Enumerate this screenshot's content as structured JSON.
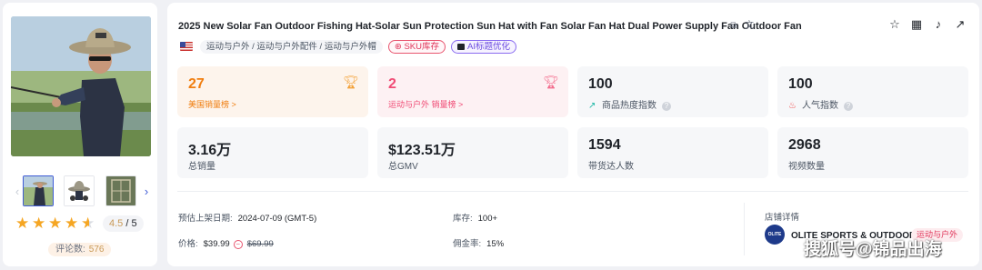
{
  "gallery": {
    "rating_score": "4.5",
    "rating_max": "/ 5",
    "rating_value": 4.5,
    "review_label": "评论数:",
    "review_count": "576"
  },
  "product": {
    "title": "2025 New Solar Fan Outdoor Fishing Hat-Solar Sun Protection Sun Hat with Fan Solar Fan Hat Dual Power Supply Fan Outdoor Fan",
    "category": "运动与户外 / 运动与户外配件 / 运动与户外帽",
    "sku_tag": "SKU库存",
    "ai_tag": "AI标题优化"
  },
  "stats": {
    "us_rank_value": "27",
    "us_rank_label": "美国销量榜 >",
    "cat_rank_value": "2",
    "cat_rank_label": "运动与户外 销量榜 >",
    "heat_value": "100",
    "heat_label": "商品热度指数",
    "pop_value": "100",
    "pop_label": "人气指数",
    "total_sales_value": "3.16万",
    "total_sales_label": "总销量",
    "gmv_value": "$123.51万",
    "gmv_label": "总GMV",
    "creators_value": "1594",
    "creators_label": "带货达人数",
    "videos_value": "2968",
    "videos_label": "视频数量"
  },
  "meta": {
    "launch_key": "预估上架日期:",
    "launch_value": "2024-07-09 (GMT-5)",
    "stock_key": "库存:",
    "stock_value": "100+",
    "price_key": "价格:",
    "price_value": "$39.99",
    "price_original": "$69.99",
    "commission_key": "佣金率:",
    "commission_value": "15%"
  },
  "store": {
    "section_title": "店铺详情",
    "logo_text": "OLITE",
    "name": "OLITE SPORTS & OUTDOOR",
    "tag": "运动与户外"
  },
  "watermark": "搜狐号@锦品出海",
  "colors": {
    "accent_orange": "#f07e10",
    "accent_pink": "#f04a74",
    "star": "#f5a623",
    "link_blue": "#3f5bd6"
  }
}
